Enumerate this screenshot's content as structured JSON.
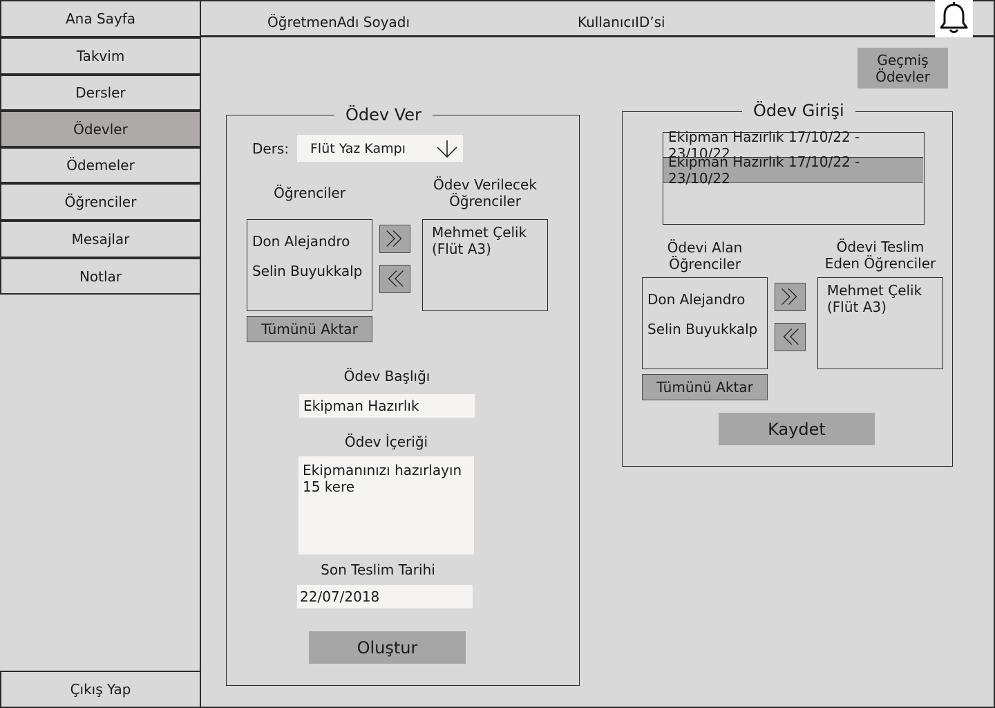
{
  "sidebar": {
    "items": [
      {
        "label": "Ana Sayfa"
      },
      {
        "label": "Takvim"
      },
      {
        "label": "Dersler"
      },
      {
        "label": "Ödevler"
      },
      {
        "label": "Ödemeler"
      },
      {
        "label": "Öğrenciler"
      },
      {
        "label": "Mesajlar"
      },
      {
        "label": "Notlar"
      }
    ],
    "logout_label": "Çıkış Yap"
  },
  "header": {
    "teacher_name": "ÖğretmenAdı Soyadı",
    "user_id": "KullanıcıID’si",
    "notification_icon": "bell-icon"
  },
  "main": {
    "past_homework_button": "Geçmiş Ödevler",
    "assign_panel": {
      "title": "Ödev Ver",
      "course_label": "Ders:",
      "course_selected": "Flüt Yaz Kampı",
      "students_label": "Öğrenciler",
      "target_students_label": "Ödev Verilecek Öğrenciler",
      "students": [
        "Don Alejandro",
        "Selin Buyukkalp"
      ],
      "target_students": [
        "Mehmet Çelik (Flüt A3)"
      ],
      "move_all_label": "Tümünü Aktar",
      "title_label": "Ödev Başlığı",
      "title_value": "Ekipman Hazırlık",
      "content_label": "Ödev İçeriği",
      "content_value": "Ekipmanınızı hazırlayın 15 kere",
      "due_label": "Son Teslim Tarihi",
      "due_value": "22/07/2018",
      "create_label": "Oluştur"
    },
    "entry_panel": {
      "title": "Ödev Girişi",
      "homework_list": [
        {
          "label": "Ekipman Hazırlık 17/10/22 - 23/10/22",
          "selected": false
        },
        {
          "label": "Ekipman Hazırlık 17/10/22 - 23/10/22",
          "selected": true
        }
      ],
      "received_label": "Ödevi Alan Öğrenciler",
      "submitted_label": "Ödevi Teslim Eden Öğrenciler",
      "received_students": [
        "Don Alejandro",
        "Selin Buyukkalp"
      ],
      "submitted_students": [
        "Mehmet Çelik (Flüt A3)"
      ],
      "move_all_label": "Tümünü Aktar",
      "save_label": "Kaydet"
    }
  },
  "colors": {
    "background": "#d9d9d9",
    "active_nav": "#aeaaaa",
    "button": "#a6a6a6",
    "field": "#f6f3f3"
  }
}
